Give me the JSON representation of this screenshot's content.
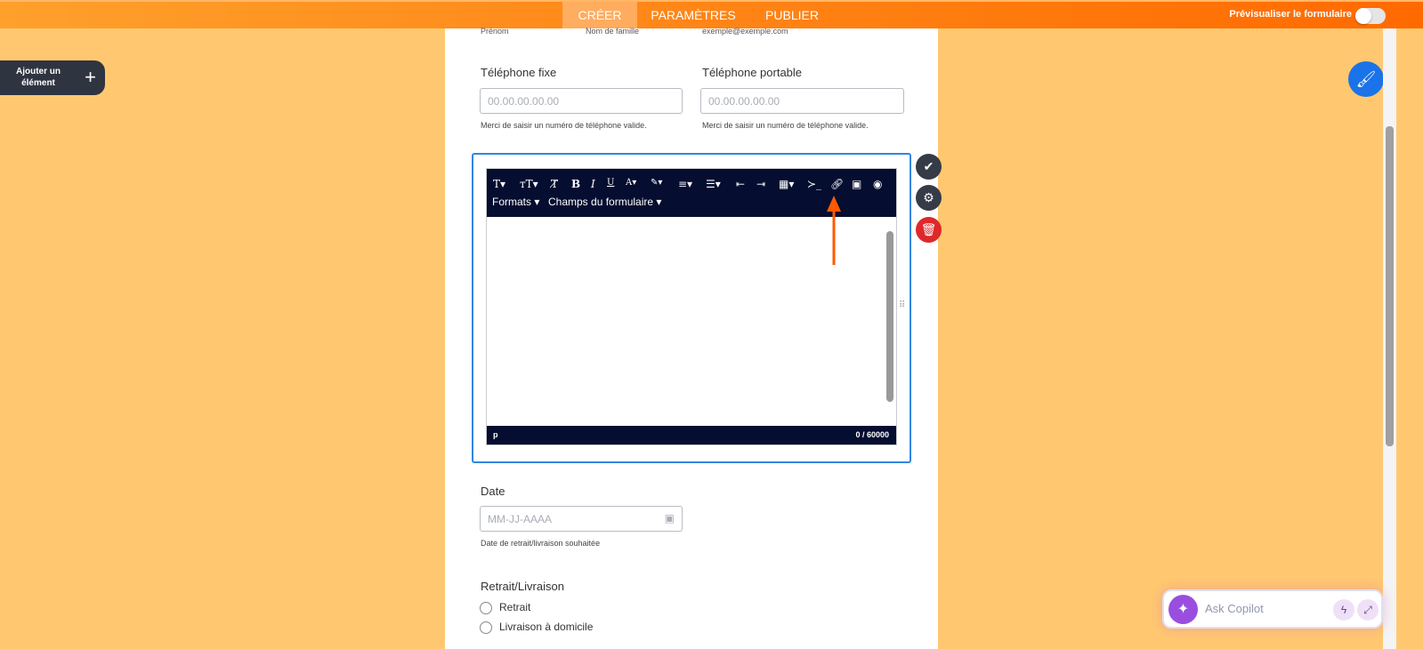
{
  "topbar": {
    "tabs": [
      "CRÉER",
      "PARAMÈTRES",
      "PUBLIER"
    ],
    "preview_label": "Prévisualiser le formulaire",
    "preview_on": false
  },
  "add_element": {
    "label": "Ajouter un élément"
  },
  "form": {
    "name_sublabels": [
      "Prénom",
      "Nom de famille",
      "exemple@exemple.com"
    ],
    "phone_fixed": {
      "label": "Téléphone fixe",
      "placeholder": "00.00.00.00.00",
      "help": "Merci de saisir un numéro de téléphone valide."
    },
    "phone_mobile": {
      "label": "Téléphone portable",
      "placeholder": "00.00.00.00.00",
      "help": "Merci de saisir un numéro de téléphone valide."
    },
    "editor": {
      "formats": "Formats",
      "form_fields": "Champs du formulaire",
      "path": "p",
      "counter": "0 / 60000"
    },
    "date": {
      "label": "Date",
      "placeholder": "MM-JJ-AAAA",
      "help": "Date de retrait/livraison souhaitée"
    },
    "pickup": {
      "label": "Retrait/Livraison",
      "options": [
        "Retrait",
        "Livraison à domicile"
      ]
    }
  },
  "copilot": {
    "placeholder": "Ask Copilot"
  },
  "colors": {
    "accent": "#ff6a00",
    "editor_bg": "#050d30",
    "selection": "#2f86e0"
  }
}
